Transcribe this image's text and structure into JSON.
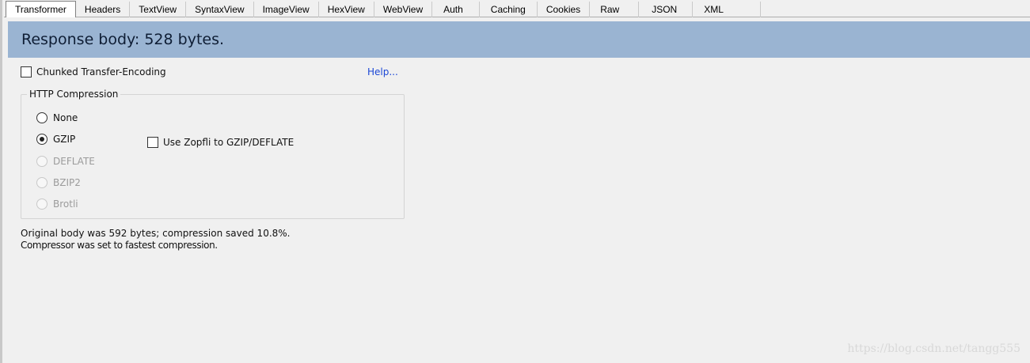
{
  "tabs": [
    {
      "label": "Transformer",
      "active": true
    },
    {
      "label": "Headers"
    },
    {
      "label": "TextView"
    },
    {
      "label": "SyntaxView"
    },
    {
      "label": "ImageView"
    },
    {
      "label": "HexView"
    },
    {
      "label": "WebView"
    },
    {
      "label": "Auth"
    },
    {
      "label": "Caching"
    },
    {
      "label": "Cookies"
    },
    {
      "label": "Raw"
    },
    {
      "label": "JSON"
    },
    {
      "label": "XML"
    }
  ],
  "header": {
    "title": "Response body: 528 bytes."
  },
  "chunked": {
    "label": "Chunked Transfer-Encoding",
    "checked": false
  },
  "help": {
    "label": "Help..."
  },
  "compression": {
    "legend": "HTTP Compression",
    "options": [
      {
        "label": "None",
        "checked": false,
        "disabled": false
      },
      {
        "label": "GZIP",
        "checked": true,
        "disabled": false
      },
      {
        "label": "DEFLATE",
        "checked": false,
        "disabled": true
      },
      {
        "label": "BZIP2",
        "checked": false,
        "disabled": true
      },
      {
        "label": "Brotli",
        "checked": false,
        "disabled": true
      }
    ],
    "zopfli": {
      "label": "Use Zopfli to GZIP/DEFLATE",
      "checked": false
    }
  },
  "status": {
    "line1": "Original body was 592 bytes; compression saved 10.8%.",
    "line2": "Compressor was set to fastest compression."
  },
  "watermark": "https://blog.csdn.net/tangg555"
}
